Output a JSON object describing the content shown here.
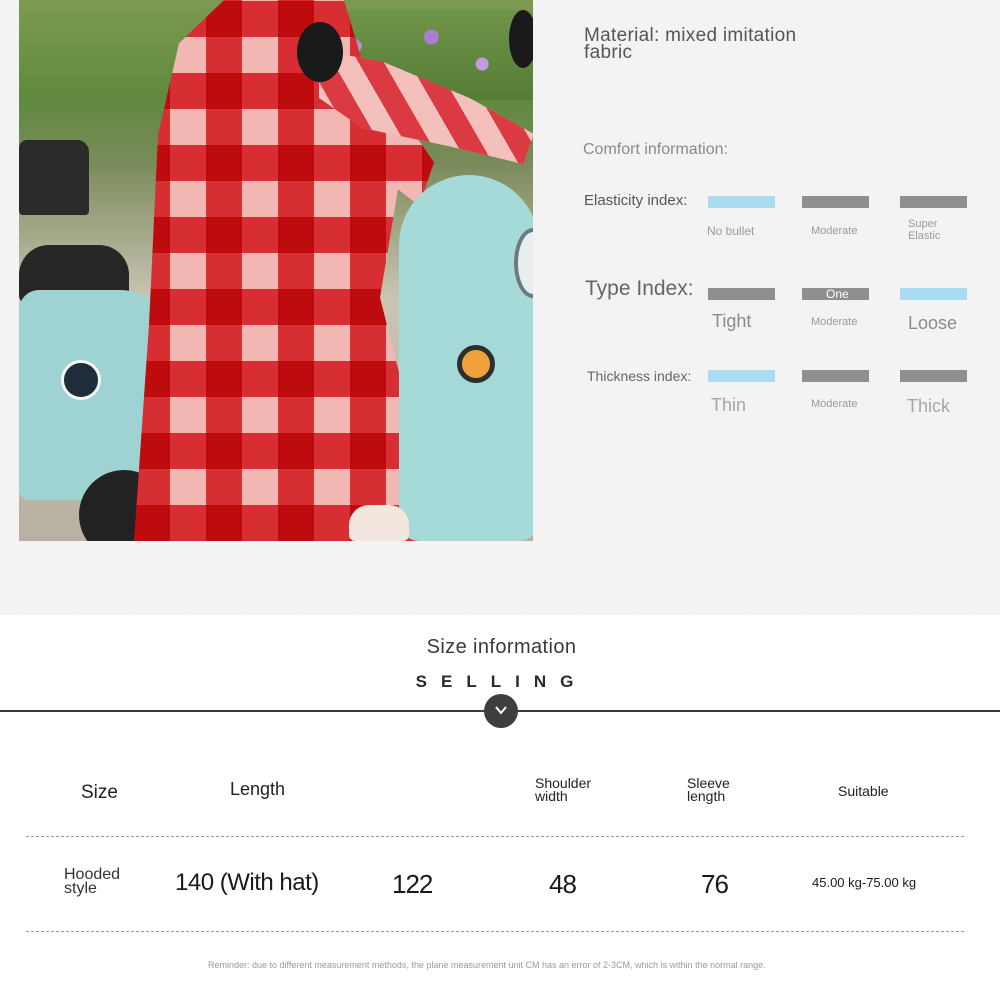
{
  "material": "Material: mixed imitation fabric",
  "comfort": {
    "title": "Comfort information:",
    "elasticity": {
      "label": "Elasticity index:",
      "options": [
        "No bullet",
        "Moderate",
        "Super Elastic"
      ],
      "selected": "No bullet"
    },
    "type": {
      "label": "Type Index:",
      "bar_caption": "One",
      "options": [
        "Tight",
        "Moderate",
        "Loose"
      ],
      "selected": "Loose"
    },
    "thickness": {
      "label": "Thickness index:",
      "options": [
        "Thin",
        "Moderate",
        "Thick"
      ],
      "selected": "Thin"
    },
    "colors": {
      "selected": "#a9dcf0",
      "unselected": "#8f8f8f"
    }
  },
  "size_info": {
    "title": "Size information",
    "subtitle": "SELLING",
    "toggle_icon": "chevron-down-icon",
    "table": {
      "headers": [
        "Size",
        "Length",
        "",
        "Shoulder width",
        "Sleeve length",
        "Suitable"
      ],
      "rows": [
        [
          "Hooded style",
          "140 (With hat)",
          "122",
          "48",
          "76",
          "45.00 kg-75.00 kg"
        ]
      ]
    },
    "reminder": "Reminder: due to different measurement methods, the plane measurement unit CM has an error of 2-3CM, which is within the normal range."
  }
}
